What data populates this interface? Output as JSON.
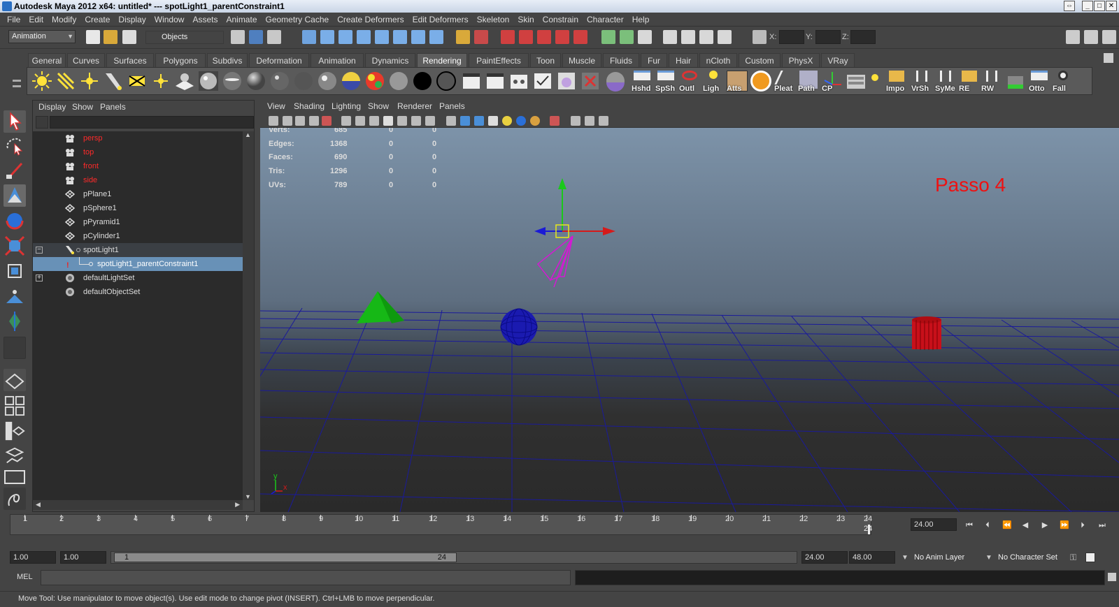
{
  "window": {
    "title": "Autodesk Maya 2012 x64: untitled*   ---   spotLight1_parentConstraint1"
  },
  "menubar": [
    "File",
    "Edit",
    "Modify",
    "Create",
    "Display",
    "Window",
    "Assets",
    "Animate",
    "Geometry Cache",
    "Create Deformers",
    "Edit Deformers",
    "Skeleton",
    "Skin",
    "Constrain",
    "Character",
    "Help"
  ],
  "statusline": {
    "menuset": "Animation",
    "selection_mode": "Objects",
    "x_label": "X:",
    "y_label": "Y:",
    "z_label": "Z:"
  },
  "shelf": {
    "tabs": [
      "General",
      "Curves",
      "Surfaces",
      "Polygons",
      "Subdivs",
      "Deformation",
      "Animation",
      "Dynamics",
      "Rendering",
      "PaintEffects",
      "Toon",
      "Muscle",
      "Fluids",
      "Fur",
      "Hair",
      "nCloth",
      "Custom",
      "PhysX",
      "VRay"
    ],
    "active_tab": "Rendering",
    "icon_labels": [
      "Hshd",
      "SpSh",
      "Outl",
      "Ligh",
      "Atts",
      "Pleat",
      "Path",
      "CP",
      "Impo",
      "VrSh",
      "SyMe",
      "RE",
      "RW",
      "Otto",
      "Fall"
    ]
  },
  "outliner": {
    "menus": [
      "Display",
      "Show",
      "Panels"
    ],
    "items": [
      {
        "name": "persp",
        "color": "#ff2a2a"
      },
      {
        "name": "top",
        "color": "#ff2a2a"
      },
      {
        "name": "front",
        "color": "#ff2a2a"
      },
      {
        "name": "side",
        "color": "#ff2a2a"
      },
      {
        "name": "pPlane1",
        "color": "#dddddd"
      },
      {
        "name": "pSphere1",
        "color": "#dddddd"
      },
      {
        "name": "pPyramid1",
        "color": "#dddddd"
      },
      {
        "name": "pCylinder1",
        "color": "#dddddd"
      },
      {
        "name": "spotLight1",
        "color": "#dddddd",
        "expand": "−"
      },
      {
        "name": "spotLight1_parentConstraint1",
        "color": "#ffffff",
        "selected": true
      },
      {
        "name": "defaultLightSet",
        "color": "#dddddd",
        "expand": "+"
      },
      {
        "name": "defaultObjectSet",
        "color": "#dddddd"
      }
    ]
  },
  "viewport": {
    "menus": [
      "View",
      "Shading",
      "Lighting",
      "Show",
      "Renderer",
      "Panels"
    ],
    "hud": [
      {
        "label": "Verts:",
        "v1": "685",
        "v2": "0",
        "v3": "0"
      },
      {
        "label": "Edges:",
        "v1": "1368",
        "v2": "0",
        "v3": "0"
      },
      {
        "label": "Faces:",
        "v1": "690",
        "v2": "0",
        "v3": "0"
      },
      {
        "label": "Tris:",
        "v1": "1296",
        "v2": "0",
        "v3": "0"
      },
      {
        "label": "UVs:",
        "v1": "789",
        "v2": "0",
        "v3": "0"
      }
    ],
    "annotation": "Passo 4",
    "axis_x": "x",
    "axis_y": "y"
  },
  "timeline": {
    "frames": [
      "1",
      "2",
      "3",
      "4",
      "5",
      "6",
      "7",
      "8",
      "9",
      "10",
      "11",
      "12",
      "13",
      "14",
      "15",
      "16",
      "17",
      "18",
      "19",
      "20",
      "21",
      "22",
      "23",
      "24"
    ],
    "current_frame": "24",
    "current_time_field": "24.00"
  },
  "range": {
    "start_time": "1.00",
    "playback_start": "1.00",
    "range_start_label": "1",
    "range_end_label": "24",
    "playback_end": "24.00",
    "end_time": "48.00",
    "anim_layer": "No Anim Layer",
    "character_set": "No Character Set"
  },
  "command_line": {
    "label": "MEL"
  },
  "help_line": "Move Tool: Use manipulator to move object(s). Use edit mode to change pivot (INSERT).  Ctrl+LMB to move perpendicular."
}
